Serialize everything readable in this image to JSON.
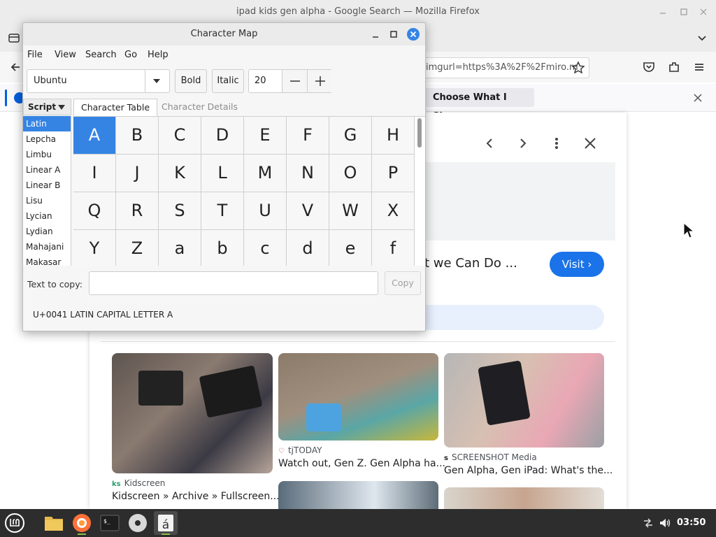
{
  "firefox": {
    "window_title": "ipad kids gen alpha - Google Search — Mozilla Firefox",
    "url_fragment": "imgurl=https%3A%2F%2Fmiro.m",
    "notification_button": "Choose What I Share",
    "result_title_fragment": "at we Can Do ...",
    "visit_label": "Visit",
    "images": [
      {
        "source_icon": "ks",
        "source": "Kidscreen",
        "caption": "Kidscreen » Archive » Fullscreen..."
      },
      {
        "source_icon": "♡",
        "source": "tjTODAY",
        "caption": "Watch out, Gen Z. Gen Alpha ha..."
      },
      {
        "source_icon": "s",
        "source": "SCREENSHOT Media",
        "caption": "Gen Alpha, Gen iPad: What's the..."
      }
    ]
  },
  "charmap": {
    "title": "Character Map",
    "menu": [
      "File",
      "View",
      "Search",
      "Go",
      "Help"
    ],
    "font": "Ubuntu",
    "bold_label": "Bold",
    "italic_label": "Italic",
    "size": "20",
    "script_header": "Script",
    "scripts": [
      "Latin",
      "Lepcha",
      "Limbu",
      "Linear A",
      "Linear B",
      "Lisu",
      "Lycian",
      "Lydian",
      "Mahajani",
      "Makasar"
    ],
    "selected_script": "Latin",
    "tabs": [
      "Character Table",
      "Character Details"
    ],
    "characters": [
      "A",
      "B",
      "C",
      "D",
      "E",
      "F",
      "G",
      "H",
      "I",
      "J",
      "K",
      "L",
      "M",
      "N",
      "O",
      "P",
      "Q",
      "R",
      "S",
      "T",
      "U",
      "V",
      "W",
      "X",
      "Y",
      "Z",
      "a",
      "b",
      "c",
      "d",
      "e",
      "f"
    ],
    "selected_char": "A",
    "copy_label": "Text to copy:",
    "copy_value": "",
    "copy_button": "Copy",
    "status": "U+0041 LATIN CAPITAL LETTER A"
  },
  "taskbar": {
    "apps": [
      "menu-icon",
      "files-icon",
      "firefox-icon",
      "terminal-icon",
      "disc-icon",
      "charmap-icon"
    ],
    "time": "03:50"
  },
  "colors": {
    "selection": "#3584e4",
    "google_blue": "#1a73e8",
    "taskbar": "#2d2d2d"
  }
}
